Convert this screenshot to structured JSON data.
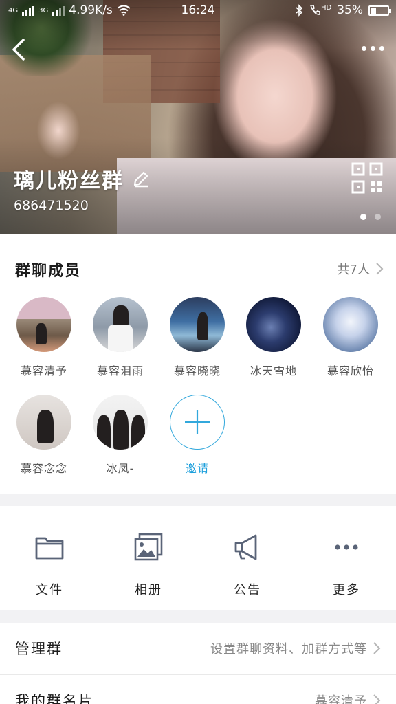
{
  "status_bar": {
    "network": "4G",
    "network2": "3G",
    "speed": "4.99K/s",
    "time": "16:24",
    "hd": "HD",
    "battery": "35%",
    "battery_level": 0.35
  },
  "header": {
    "group_name": "璃儿粉丝群",
    "group_id": "686471520",
    "icons": [
      "back-arrow-icon",
      "more-icon",
      "edit-icon",
      "qr-code-icon"
    ],
    "carousel_current": 1,
    "carousel_total": 2
  },
  "members": {
    "title": "群聊成员",
    "count_label": "共7人",
    "items": [
      {
        "name": "慕容清予"
      },
      {
        "name": "慕容泪雨"
      },
      {
        "name": "慕容晓晓"
      },
      {
        "name": "冰天雪地"
      },
      {
        "name": "慕容欣怡"
      },
      {
        "name": "慕容念念"
      },
      {
        "name": "冰凤-"
      }
    ],
    "invite_label": "邀请"
  },
  "actions": [
    {
      "label": "文件",
      "icon": "folder-icon"
    },
    {
      "label": "相册",
      "icon": "album-icon"
    },
    {
      "label": "公告",
      "icon": "megaphone-icon"
    },
    {
      "label": "更多",
      "icon": "more-dots-icon"
    }
  ],
  "rows": [
    {
      "title": "管理群",
      "value": "设置群聊资料、加群方式等"
    },
    {
      "title": "我的群名片",
      "value": "慕容清予"
    }
  ],
  "colors": {
    "accent": "#1ea0dc",
    "icon_gray": "#5a6478",
    "background": "#f2f2f4"
  }
}
